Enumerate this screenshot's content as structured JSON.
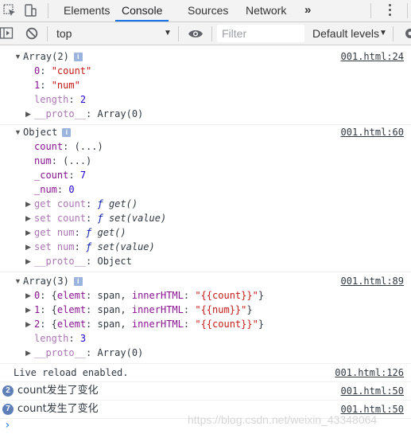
{
  "tabs": {
    "items": [
      "Elements",
      "Console",
      "Sources",
      "Network"
    ],
    "active": "Console",
    "more": "»"
  },
  "toolbar": {
    "context": "top",
    "filter_placeholder": "Filter",
    "levels": "Default levels"
  },
  "messages": {
    "m1": {
      "source": "001.html:24",
      "header": "Array(2)",
      "info": "i",
      "l1_key": "0",
      "l1_val": "\"count\"",
      "l2_key": "1",
      "l2_val": "\"num\"",
      "l3_key": "length",
      "l3_val": "2",
      "l4_key": "__proto__",
      "l4_val": "Array(0)"
    },
    "m2": {
      "source": "001.html:60",
      "header": "Object",
      "info": "i",
      "count_key": "count",
      "count_val": "(...)",
      "num_key": "num",
      "num_val": "(...)",
      "_count_key": "_count",
      "_count_val": "7",
      "_num_key": "_num",
      "_num_val": "0",
      "get_count_key": "get count",
      "get_count_val": "get()",
      "set_count_key": "set count",
      "set_count_val": "set(value)",
      "get_num_key": "get num",
      "get_num_val": "get()",
      "set_num_key": "set num",
      "set_num_val": "set(value)",
      "proto_key": "__proto__",
      "proto_val": "Object",
      "f": "ƒ"
    },
    "m3": {
      "source": "001.html:89",
      "header": "Array(3)",
      "info": "i",
      "r0_idx": "0",
      "r0_tag": "span",
      "r0_html": "\"{{count}}\"",
      "r1_idx": "1",
      "r1_tag": "span",
      "r1_html": "\"{{num}}\"",
      "r2_idx": "2",
      "r2_tag": "span",
      "r2_html": "\"{{count}}\"",
      "elemt_key": "elemt",
      "inner_key": "innerHTML",
      "length_key": "length",
      "length_val": "3",
      "proto_key": "__proto__",
      "proto_val": "Array(0)"
    },
    "m4": {
      "text": "Live reload enabled.",
      "source": "001.html:126"
    },
    "m5": {
      "count": "2",
      "text": "count发生了变化",
      "source": "001.html:50"
    },
    "m6": {
      "count": "7",
      "text": "count发生了变化",
      "source": "001.html:50"
    }
  },
  "prompt": "›",
  "watermark": "https://blog.csdn.net/weixin_43348064"
}
